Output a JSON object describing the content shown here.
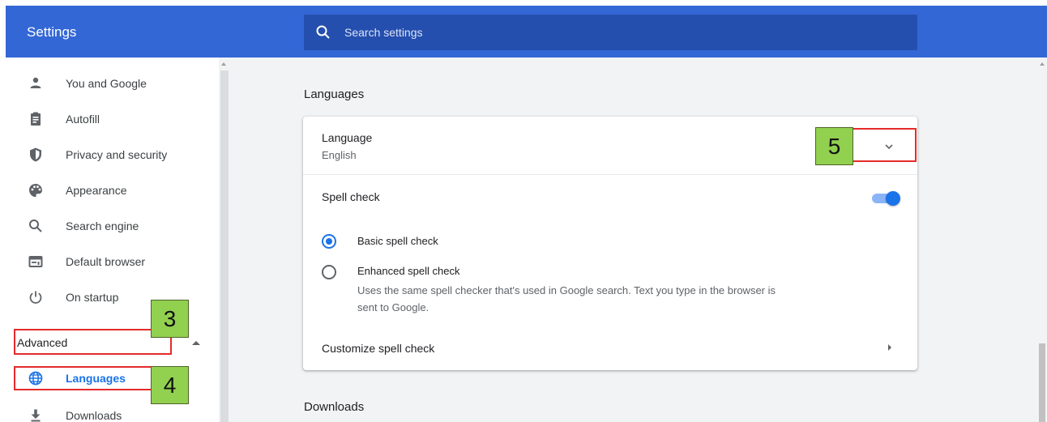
{
  "app": {
    "title": "Settings"
  },
  "search": {
    "placeholder": "Search settings"
  },
  "sidebar": {
    "items": [
      {
        "label": "You and Google",
        "icon": "person-icon"
      },
      {
        "label": "Autofill",
        "icon": "clipboard-icon"
      },
      {
        "label": "Privacy and security",
        "icon": "shield-icon"
      },
      {
        "label": "Appearance",
        "icon": "palette-icon"
      },
      {
        "label": "Search engine",
        "icon": "search-icon"
      },
      {
        "label": "Default browser",
        "icon": "browser-window-icon"
      },
      {
        "label": "On startup",
        "icon": "power-icon"
      }
    ],
    "advanced_label": "Advanced",
    "advanced_items": [
      {
        "label": "Languages",
        "icon": "globe-icon",
        "active": true
      },
      {
        "label": "Downloads",
        "icon": "download-icon"
      }
    ]
  },
  "main": {
    "languages_title": "Languages",
    "language": {
      "title": "Language",
      "value": "English"
    },
    "spell_check": {
      "label": "Spell check",
      "enabled": true,
      "options": [
        {
          "label": "Basic spell check",
          "selected": true
        },
        {
          "label": "Enhanced spell check",
          "selected": false,
          "description": "Uses the same spell checker that's used in Google search. Text you type in the browser is sent to Google."
        }
      ],
      "customize_label": "Customize spell check"
    },
    "downloads_title": "Downloads"
  },
  "annotations": {
    "steps": [
      "3",
      "4",
      "5"
    ]
  },
  "colors": {
    "header": "#3367d6",
    "search_bg": "#254fae",
    "accent": "#1a73e8",
    "highlight": "#e52b2b",
    "step_badge": "#92d050"
  }
}
